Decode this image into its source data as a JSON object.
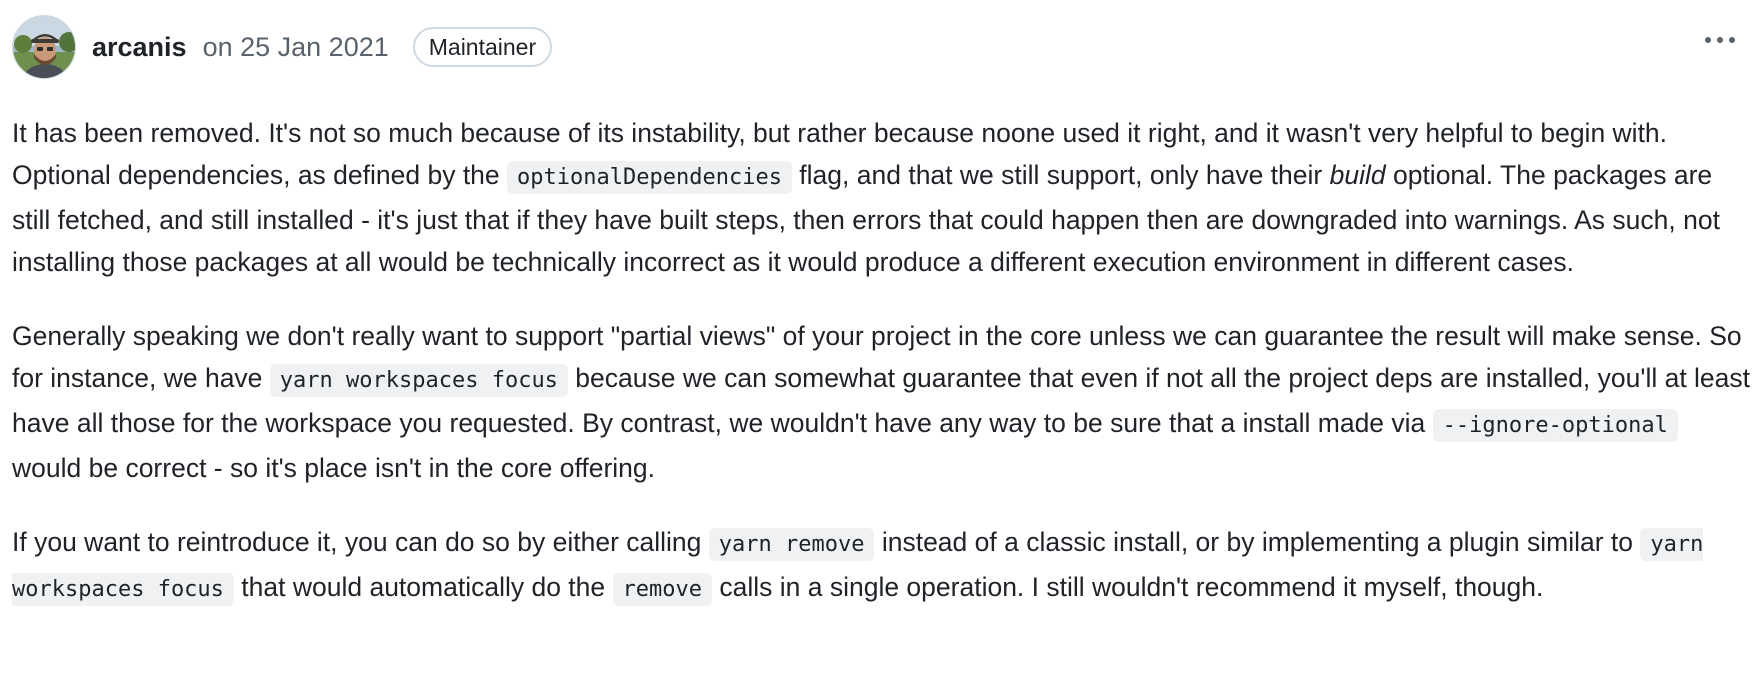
{
  "comment": {
    "author": "arcanis",
    "date": "on 25 Jan 2021",
    "badge": "Maintainer",
    "avatar_icon": "user-avatar",
    "more_icon": "kebab-horizontal-icon",
    "paragraphs": [
      {
        "segments": [
          {
            "type": "text",
            "value": "It has been removed. It's not so much because of its instability, but rather because noone used it right, and it wasn't very helpful to begin with. Optional dependencies, as defined by the "
          },
          {
            "type": "code",
            "value": "optionalDependencies"
          },
          {
            "type": "text",
            "value": " flag, and that we still support, only have their "
          },
          {
            "type": "em",
            "value": "build"
          },
          {
            "type": "text",
            "value": " optional. The packages are still fetched, and still installed - it's just that if they have built steps, then errors that could happen then are downgraded into warnings. As such, not installing those packages at all would be technically incorrect as it would produce a different execution environment in different cases."
          }
        ]
      },
      {
        "segments": [
          {
            "type": "text",
            "value": "Generally speaking we don't really want to support \"partial views\" of your project in the core unless we can guarantee the result will make sense. So for instance, we have "
          },
          {
            "type": "code",
            "value": "yarn workspaces focus"
          },
          {
            "type": "text",
            "value": " because we can somewhat guarantee that even if not all the project deps are installed, you'll at least have all those for the workspace you requested. By contrast, we wouldn't have any way to be sure that a install made via "
          },
          {
            "type": "code",
            "value": "--ignore-optional"
          },
          {
            "type": "text",
            "value": " would be correct - so it's place isn't in the core offering."
          }
        ]
      },
      {
        "segments": [
          {
            "type": "text",
            "value": "If you want to reintroduce it, you can do so by either calling "
          },
          {
            "type": "code",
            "value": "yarn remove"
          },
          {
            "type": "text",
            "value": " instead of a classic install, or by implementing a plugin similar to "
          },
          {
            "type": "code",
            "value": "yarn workspaces focus"
          },
          {
            "type": "text",
            "value": " that would automatically do the "
          },
          {
            "type": "code",
            "value": "remove"
          },
          {
            "type": "text",
            "value": " calls in a single operation. I still wouldn't recommend it myself, though."
          }
        ]
      }
    ]
  }
}
